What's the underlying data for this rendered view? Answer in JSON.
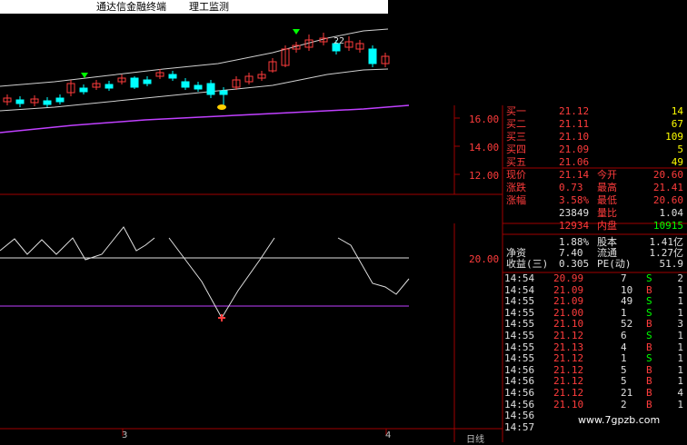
{
  "window": {
    "app_title": "通达信金融终端",
    "module_title": "理工监测"
  },
  "price_axis": [
    "16.00",
    "14.00",
    "12.00"
  ],
  "indicator_axis": "20.00",
  "date_marks": [
    "3",
    "4"
  ],
  "period_label": "日线",
  "candle_label": "22",
  "watermark": "www.7gpzb.com",
  "quotes": {
    "asks": [
      {
        "label": "买一",
        "price": "21.12",
        "vol": "14"
      },
      {
        "label": "买二",
        "price": "21.11",
        "vol": "67"
      },
      {
        "label": "买三",
        "price": "21.10",
        "vol": "109"
      },
      {
        "label": "买四",
        "price": "21.09",
        "vol": "5"
      },
      {
        "label": "买五",
        "price": "21.06",
        "vol": "49"
      }
    ],
    "stats": [
      {
        "l1": "现价",
        "v1": "21.14",
        "l2": "今开",
        "v2": "20.60"
      },
      {
        "l1": "涨跌",
        "v1": "0.73",
        "l2": "最高",
        "v2": "21.41"
      },
      {
        "l1": "涨幅",
        "v1": "3.58%",
        "l2": "最低",
        "v2": "20.60"
      }
    ],
    "vol_row": {
      "v1": "23849",
      "l2": "量比",
      "v2": "1.04"
    },
    "outer_row": {
      "v1": "12934",
      "l2": "内盘",
      "v2": "10915"
    },
    "cap_rows": [
      {
        "l1": "",
        "v1": "1.88%",
        "l2": "股本",
        "v2": "1.41亿"
      },
      {
        "l1": "净资",
        "v1": "7.40",
        "l2": "流通",
        "v2": "1.27亿"
      },
      {
        "l1": "收益(三)",
        "v1": "0.305",
        "l2": "PE(动)",
        "v2": "51.9"
      }
    ]
  },
  "ticks": [
    {
      "time": "14:54",
      "price": "20.99",
      "vol": "7",
      "side": "S",
      "n": "2"
    },
    {
      "time": "14:54",
      "price": "21.09",
      "vol": "10",
      "side": "B",
      "n": "1"
    },
    {
      "time": "14:55",
      "price": "21.09",
      "vol": "49",
      "side": "S",
      "n": "1"
    },
    {
      "time": "14:55",
      "price": "21.00",
      "vol": "1",
      "side": "S",
      "n": "1"
    },
    {
      "time": "14:55",
      "price": "21.10",
      "vol": "52",
      "side": "B",
      "n": "3"
    },
    {
      "time": "14:55",
      "price": "21.12",
      "vol": "6",
      "side": "S",
      "n": "1"
    },
    {
      "time": "14:55",
      "price": "21.13",
      "vol": "4",
      "side": "B",
      "n": "1"
    },
    {
      "time": "14:55",
      "price": "21.12",
      "vol": "1",
      "side": "S",
      "n": "1"
    },
    {
      "time": "14:56",
      "price": "21.12",
      "vol": "5",
      "side": "B",
      "n": "1"
    },
    {
      "time": "14:56",
      "price": "21.12",
      "vol": "5",
      "side": "B",
      "n": "1"
    },
    {
      "time": "14:56",
      "price": "21.12",
      "vol": "21",
      "side": "B",
      "n": "4"
    },
    {
      "time": "14:56",
      "price": "21.10",
      "vol": "2",
      "side": "B",
      "n": "1"
    },
    {
      "time": "14:56",
      "price": "",
      "vol": "",
      "side": "",
      "n": ""
    },
    {
      "time": "14:57",
      "price": "",
      "vol": "",
      "side": "",
      "n": ""
    }
  ],
  "colors": {
    "up": "#ff3c3c",
    "down": "#00ffff",
    "grid": "#a00000",
    "ma": "#c040ff"
  }
}
